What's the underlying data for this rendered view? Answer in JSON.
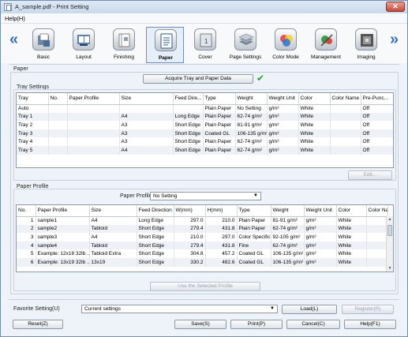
{
  "window": {
    "title": "A_sample.pdf - Print Setting",
    "close_glyph": "✕"
  },
  "menu": {
    "help": "Help(H)"
  },
  "nav": {
    "left_arrow": "«",
    "right_arrow": "»",
    "categories": [
      "Basic",
      "Layout",
      "Finishing",
      "Paper",
      "Cover",
      "Page Settings",
      "Color Mode",
      "Management",
      "Imaging"
    ],
    "active": "Paper"
  },
  "paper": {
    "section_label": "Paper",
    "acquire_button": "Acquire Tray and Paper Data",
    "acquired_check": "✔"
  },
  "tray_settings": {
    "label": "Tray Settings",
    "columns": [
      "Tray",
      "No.",
      "Paper Profile",
      "Size",
      "Feed Dire...",
      "Type",
      "Weight",
      "Weight Unit",
      "Color",
      "Color Name",
      "Pre-Punc..."
    ],
    "rows": [
      [
        "Auto",
        "",
        "",
        "",
        "",
        "Plain Paper",
        "No Setting",
        "g/m²",
        "White",
        "",
        "Off"
      ],
      [
        "Tray 1",
        "",
        "",
        "A4",
        "Long Edge",
        "Plain Paper",
        "62-74 g/m²",
        "g/m²",
        "White",
        "",
        "Off"
      ],
      [
        "Tray 2",
        "",
        "",
        "A3",
        "Short Edge",
        "Plain Paper",
        "81-91 g/m²",
        "g/m²",
        "White",
        "",
        "Off"
      ],
      [
        "Tray 3",
        "",
        "",
        "A3",
        "Short Edge",
        "Coated GL",
        "106-135 g/m²",
        "g/m²",
        "White",
        "",
        "Off"
      ],
      [
        "Tray 4",
        "",
        "",
        "A3",
        "Short Edge",
        "Plain Paper",
        "62-74 g/m²",
        "g/m²",
        "White",
        "",
        "Off"
      ],
      [
        "Tray 5",
        "",
        "",
        "A4",
        "Short Edge",
        "Plain Paper",
        "62-74 g/m²",
        "g/m²",
        "White",
        "",
        "Off"
      ]
    ],
    "edit_button": "Edit..."
  },
  "paper_profile": {
    "label": "Paper Profile",
    "select_label": "Paper Profile",
    "select_value": "No Setting",
    "columns": [
      "No.",
      "Paper Profile",
      "Size",
      "Feed Direction",
      "W(mm)",
      "H(mm)",
      "Type",
      "Weight",
      "Weight Unit",
      "Color",
      "Color Nam"
    ],
    "rows": [
      [
        "1",
        "sample1",
        "A4",
        "Long Edge",
        "297.0",
        "210.0",
        "Plain Paper",
        "81-91 g/m²",
        "g/m²",
        "White",
        ""
      ],
      [
        "2",
        "sample2",
        "Tabloid",
        "Short Edge",
        "279.4",
        "431.8",
        "Plain Paper",
        "62-74 g/m²",
        "g/m²",
        "White",
        ""
      ],
      [
        "3",
        "sample3",
        "A4",
        "Short Edge",
        "210.0",
        "297.0",
        "Color Specific",
        "92-105 g/m²",
        "g/m²",
        "White",
        ""
      ],
      [
        "4",
        "sample4",
        "Tabloid",
        "Short Edge",
        "279.4",
        "431.8",
        "Fine",
        "62-74 g/m²",
        "g/m²",
        "White",
        ""
      ],
      [
        "5",
        "Example: 12x18 32lb ...",
        "Tabloid Extra",
        "Short Edge",
        "304.8",
        "457.2",
        "Coated GL",
        "106-135 g/m²",
        "g/m²",
        "White",
        ""
      ],
      [
        "6",
        "Example: 13x19 32lb ...",
        "13x19",
        "Short Edge",
        "330.2",
        "482.6",
        "Coated GL",
        "106-135 g/m²",
        "g/m²",
        "White",
        ""
      ]
    ],
    "use_button": "Use the Selected Profile"
  },
  "favorite": {
    "label": "Favorite Setting(U)",
    "value": "Current settings",
    "load_button": "Load(L)",
    "register_button": "Register(R)"
  },
  "footer": {
    "reset": "Reset(Z)",
    "save": "Save(S)",
    "print": "Print(P)",
    "cancel": "Cancel(C)",
    "help": "Help(F1)"
  },
  "colors": {
    "accent": "#3c6fb0",
    "check": "#2e9d3a",
    "border": "#8f99a5"
  }
}
